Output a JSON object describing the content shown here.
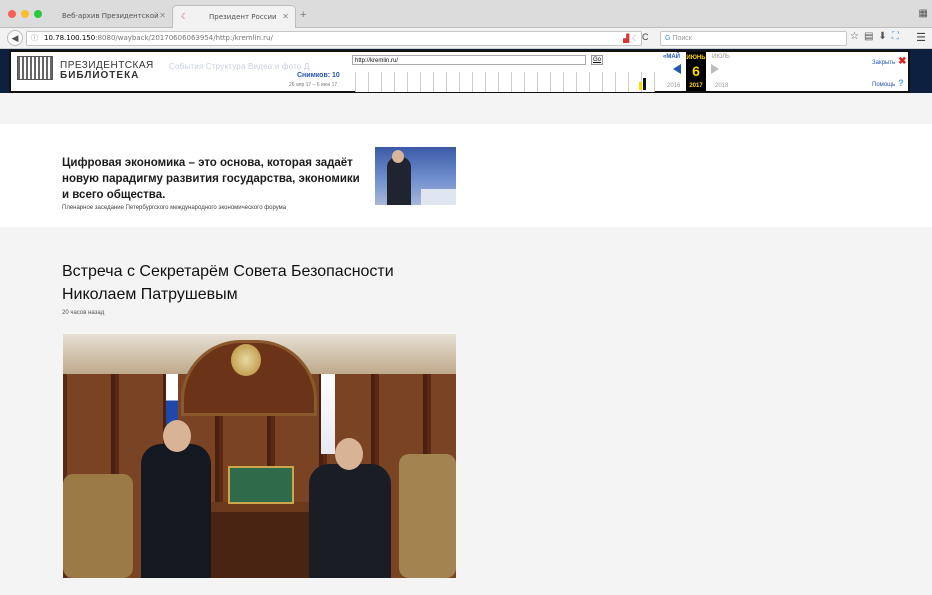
{
  "browser": {
    "tabs": [
      {
        "label": "Веб-архив Президентской библ",
        "active": false
      },
      {
        "label": "Президент России",
        "active": true
      }
    ],
    "new_tab": "+",
    "address": {
      "host": "10.78.100.150",
      "rest": ":8080/wayback/20170606063954/http:/kremlin.ru/"
    },
    "search_placeholder": "Поиск",
    "colors": {
      "tab_bar": "#dcdcdc",
      "accent": "#2356b5"
    }
  },
  "wayback": {
    "logo_line1": "ПРЕЗИДЕНТСКАЯ",
    "logo_line2": "БИБЛИОТЕКА",
    "ghost_nav": "События   Структура   Видео и фото   Д",
    "snapshots": "Снимков: 10",
    "range": "26 апр 17 – 6 июн 17",
    "url_value": "http://kremlin.ru/",
    "go_label": "Go",
    "prev_month": "«МАЙ",
    "cur_month": "ИЮНЬ",
    "cur_day": "6",
    "cur_year": "2017",
    "next_month": "ИЮЛЬ",
    "prev_year": "2016",
    "next_year": "2018",
    "close_label": "Закрыть",
    "help_label": "Помощь"
  },
  "main": {
    "quote_text": "Цифровая экономика – это основа, которая задаёт новую парадигму развития государства, экономики и всего общества.",
    "quote_sub": "Пленарное заседание Петербургского международного экономического форума",
    "news_title": "Встреча с Секретарём Совета Безопасности Николаем Патрушевым",
    "news_time": "20 часов назад"
  }
}
